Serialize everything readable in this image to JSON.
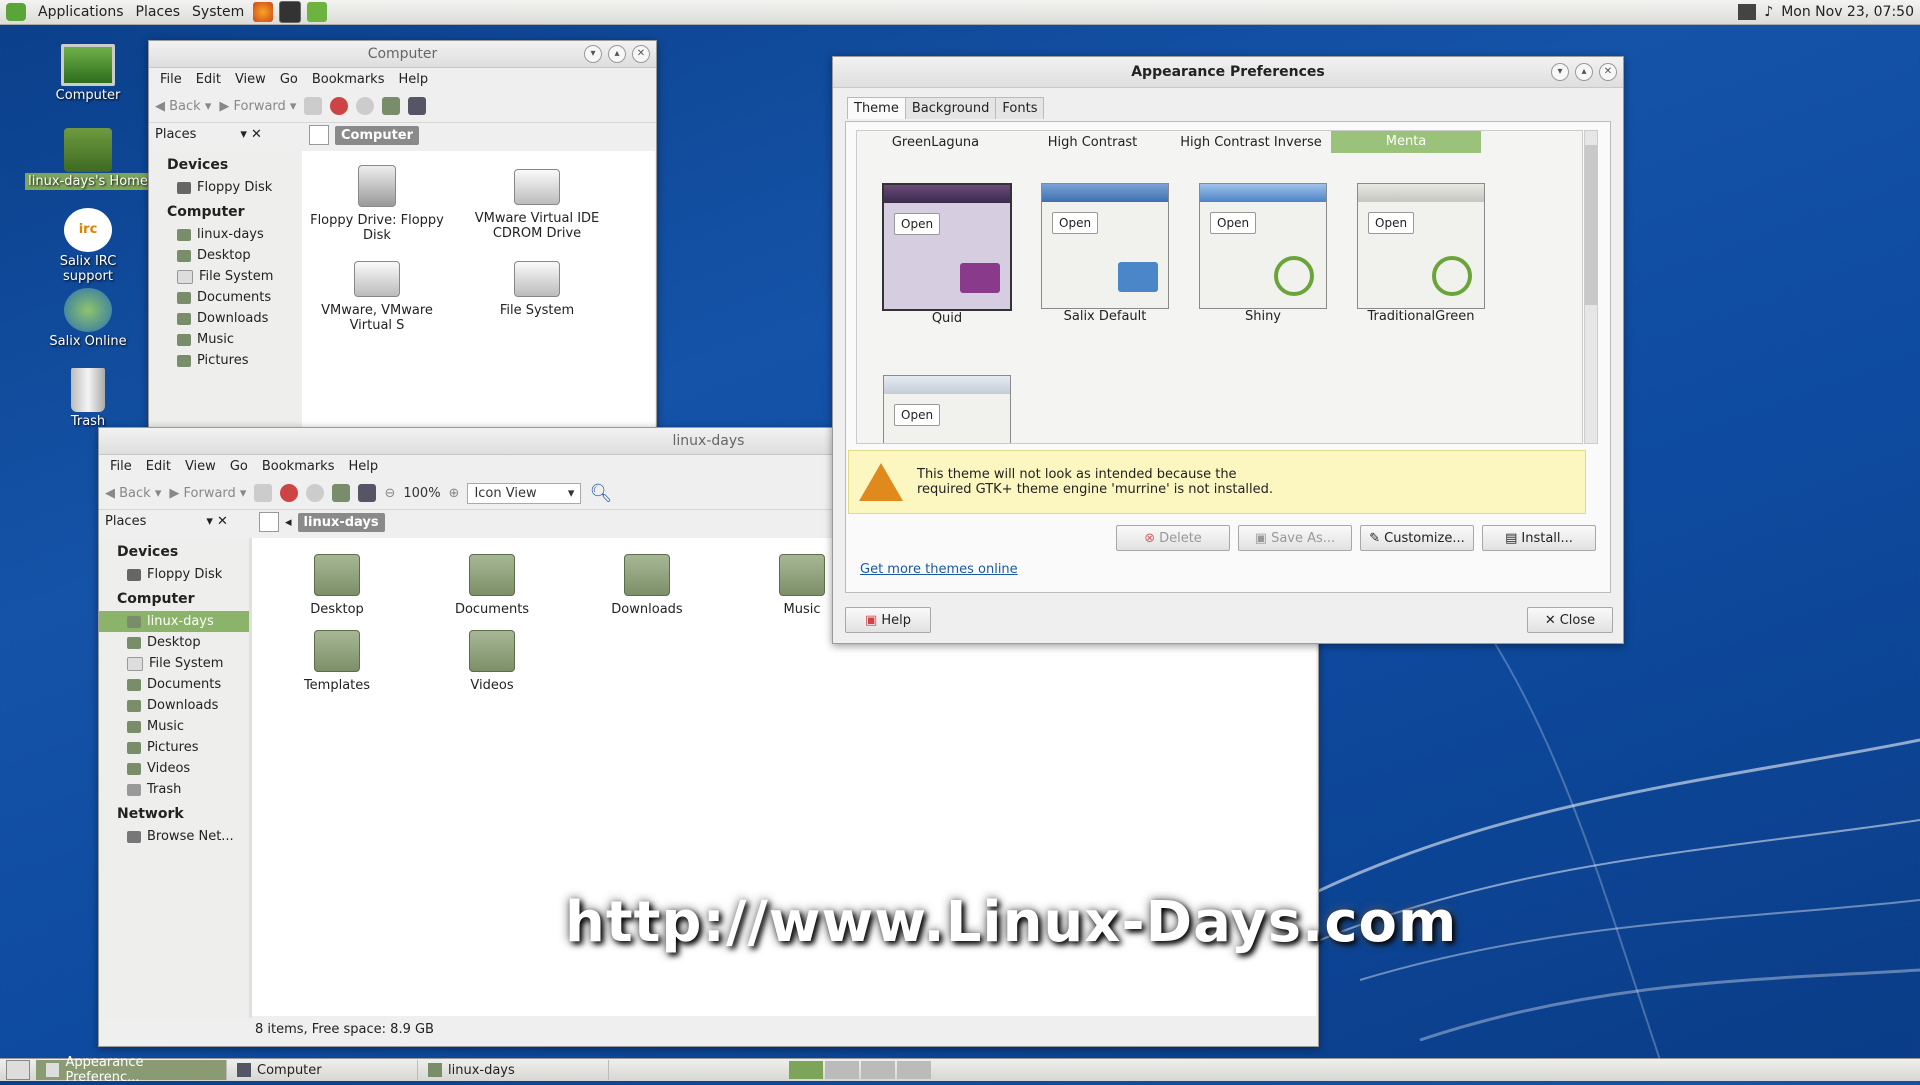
{
  "top_panel": {
    "menus": [
      "Applications",
      "Places",
      "System"
    ],
    "clock": "Mon Nov 23, 07:50"
  },
  "desktop_icons": [
    "Computer",
    "linux-days's Home",
    "Salix IRC support",
    "Salix Online",
    "Trash"
  ],
  "computer_window": {
    "title": "Computer",
    "menus": [
      "File",
      "Edit",
      "View",
      "Go",
      "Bookmarks",
      "Help"
    ],
    "toolbar": {
      "back": "Back",
      "forward": "Forward"
    },
    "places_label": "Places",
    "location": "Computer",
    "sidebar": {
      "devices_header": "Devices",
      "devices": [
        "Floppy Disk"
      ],
      "computer_header": "Computer",
      "computer": [
        "linux-days",
        "Desktop",
        "File System",
        "Documents",
        "Downloads",
        "Music",
        "Pictures"
      ]
    },
    "items": [
      "Floppy Drive: Floppy Disk",
      "VMware Virtual IDE CDROM Drive",
      "VMware, VMware Virtual S",
      "File System"
    ]
  },
  "home_window": {
    "title": "linux-days",
    "menus": [
      "File",
      "Edit",
      "View",
      "Go",
      "Bookmarks",
      "Help"
    ],
    "toolbar": {
      "back": "Back",
      "forward": "Forward",
      "zoom": "100%",
      "view_mode": "Icon View"
    },
    "places_label": "Places",
    "location": "linux-days",
    "sidebar": {
      "devices_header": "Devices",
      "devices": [
        "Floppy Disk"
      ],
      "computer_header": "Computer",
      "computer": [
        "linux-days",
        "Desktop",
        "File System",
        "Documents",
        "Downloads",
        "Music",
        "Pictures",
        "Videos",
        "Trash"
      ],
      "network_header": "Network",
      "network": [
        "Browse Net..."
      ]
    },
    "items": [
      "Desktop",
      "Documents",
      "Downloads",
      "Music",
      "Templates",
      "Videos"
    ],
    "status": "8 items, Free space: 8.9 GB"
  },
  "appearance_window": {
    "title": "Appearance Preferences",
    "tabs": [
      "Theme",
      "Background",
      "Fonts"
    ],
    "theme_header_row": [
      "GreenLaguna",
      "High Contrast",
      "High Contrast Inverse",
      "Menta"
    ],
    "themes": [
      "Quid",
      "Salix Default",
      "Shiny",
      "TraditionalGreen"
    ],
    "preview_open_label": "Open",
    "warning_line1": "This theme will not look as intended because the",
    "warning_line2": "required GTK+ theme engine 'murrine' is not installed.",
    "buttons": {
      "delete": "Delete",
      "save_as": "Save As...",
      "customize": "Customize...",
      "install": "Install..."
    },
    "more_themes_link": "Get more themes online",
    "help": "Help",
    "close": "Close"
  },
  "taskbar": {
    "tasks": [
      "Appearance Preferenc...",
      "Computer",
      "linux-days"
    ]
  },
  "watermark": "http://www.Linux-Days.com",
  "colors": {
    "selection_green": "#8bb36a",
    "desktop_blue": "#1553a8",
    "menta": "#9bc27a"
  }
}
